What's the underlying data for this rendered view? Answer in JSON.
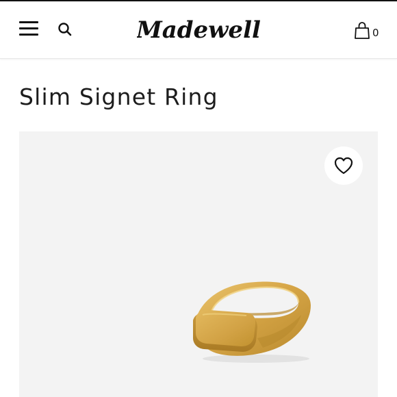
{
  "header": {
    "brand": "Madewell",
    "menu_icon": "hamburger-menu-icon",
    "search_icon": "search-icon",
    "cart_icon": "shopping-bag-icon",
    "cart_count": "0"
  },
  "product": {
    "title": "Slim Signet Ring",
    "image_subject": "gold slim signet ring",
    "wishlist_icon": "heart-icon"
  },
  "colors": {
    "text": "#1a1a1a",
    "image_background": "#f3f3f3",
    "ring_gold": "#d9a84a"
  }
}
